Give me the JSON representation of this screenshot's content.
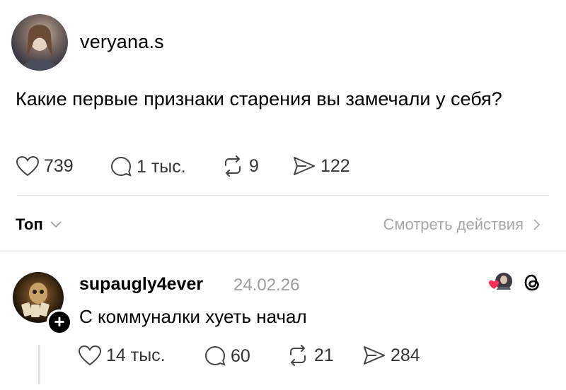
{
  "post": {
    "author": "veryana.s",
    "text": "Какие первые признаки старения вы замечали у себя?",
    "stats": {
      "likes": "739",
      "replies": "1 тыс.",
      "reposts": "9",
      "shares": "122"
    }
  },
  "sort": {
    "label": "Топ"
  },
  "activity": {
    "label": "Смотреть действия"
  },
  "reply": {
    "username": "supaugly4ever",
    "date": "24.02.26",
    "text": "С коммуналки хуеть начал",
    "stats": {
      "likes": "14 тыс.",
      "replies": "60",
      "reposts": "21",
      "shares": "284"
    }
  },
  "icons": {
    "like": "heart-icon",
    "reply": "comment-icon",
    "repost": "repost-icon",
    "share": "share-icon",
    "chevron_down": "chevron-down-icon",
    "chevron_right": "chevron-right-icon",
    "threads": "threads-logo-icon"
  },
  "colors": {
    "liked_heart": "#ff2d55",
    "muted_text": "#9b9b9b"
  }
}
